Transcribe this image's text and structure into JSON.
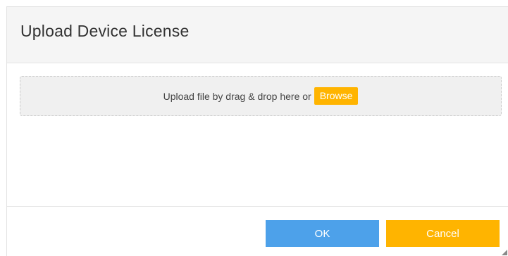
{
  "dialog": {
    "title": "Upload Device License",
    "drop_zone": {
      "text": "Upload file by drag & drop here or",
      "browse_label": "Browse"
    },
    "footer": {
      "ok_label": "OK",
      "cancel_label": "Cancel"
    }
  },
  "colors": {
    "primary": "#4da1ea",
    "accent": "#ffb400",
    "header_bg": "#f5f5f5",
    "drop_zone_bg": "#f0f0f0"
  },
  "icons": {
    "resize_grip": "resize-grip-icon"
  }
}
